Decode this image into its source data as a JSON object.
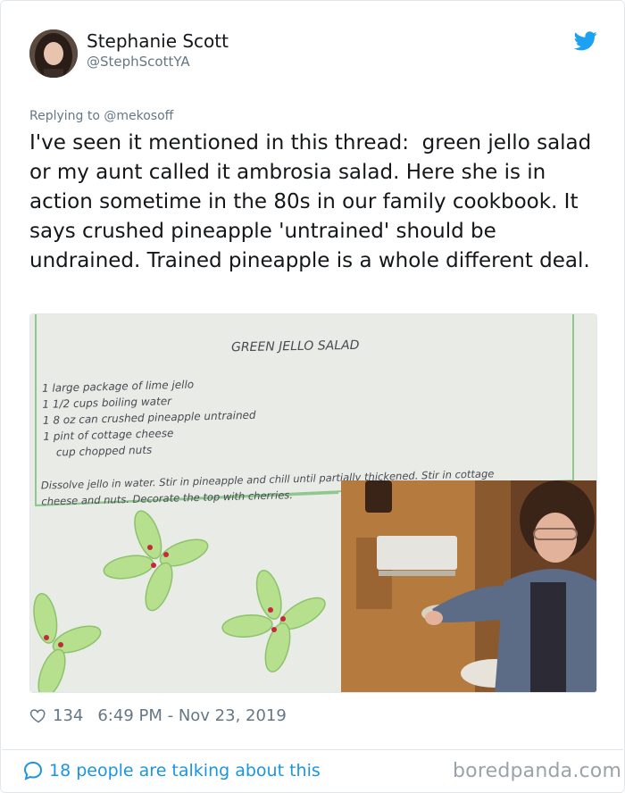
{
  "user": {
    "name": "Stephanie Scott",
    "handle": "@StephScottYA"
  },
  "tweet": {
    "replying_to": "Replying to @mekosoff",
    "text": "I've seen it mentioned in this thread:  green jello salad or my aunt called it ambrosia salad. Here she is in action sometime in the 80s in our family cookbook. It says crushed pineapple 'untrained' should be undrained. Trained pineapple is a whole different deal."
  },
  "recipe": {
    "title": "GREEN JELLO SALAD",
    "ingredients": [
      "1 large package of lime jello",
      "1 1/2 cups boiling water",
      "1 8 oz can crushed pineapple untrained",
      "1 pint of cottage cheese",
      "cup chopped nuts"
    ],
    "instructions_line1": "Dissolve jello in water. Stir in pineapple and chill until partially thickened. Stir in cottage",
    "instructions_line2": "cheese and nuts.  Decorate the top with cherries."
  },
  "stats": {
    "likes": "134",
    "timestamp": "6:49 PM - Nov 23, 2019"
  },
  "footer": {
    "talking": "18 people are talking about this",
    "watermark": "boredpanda.com"
  },
  "colors": {
    "link_blue": "#1b95e0",
    "secondary_text": "#657786",
    "twitter_blue": "#1da1f2"
  },
  "icons": {
    "bird": "twitter-bird-icon",
    "heart": "heart-icon",
    "bubble": "speech-bubble-icon"
  }
}
